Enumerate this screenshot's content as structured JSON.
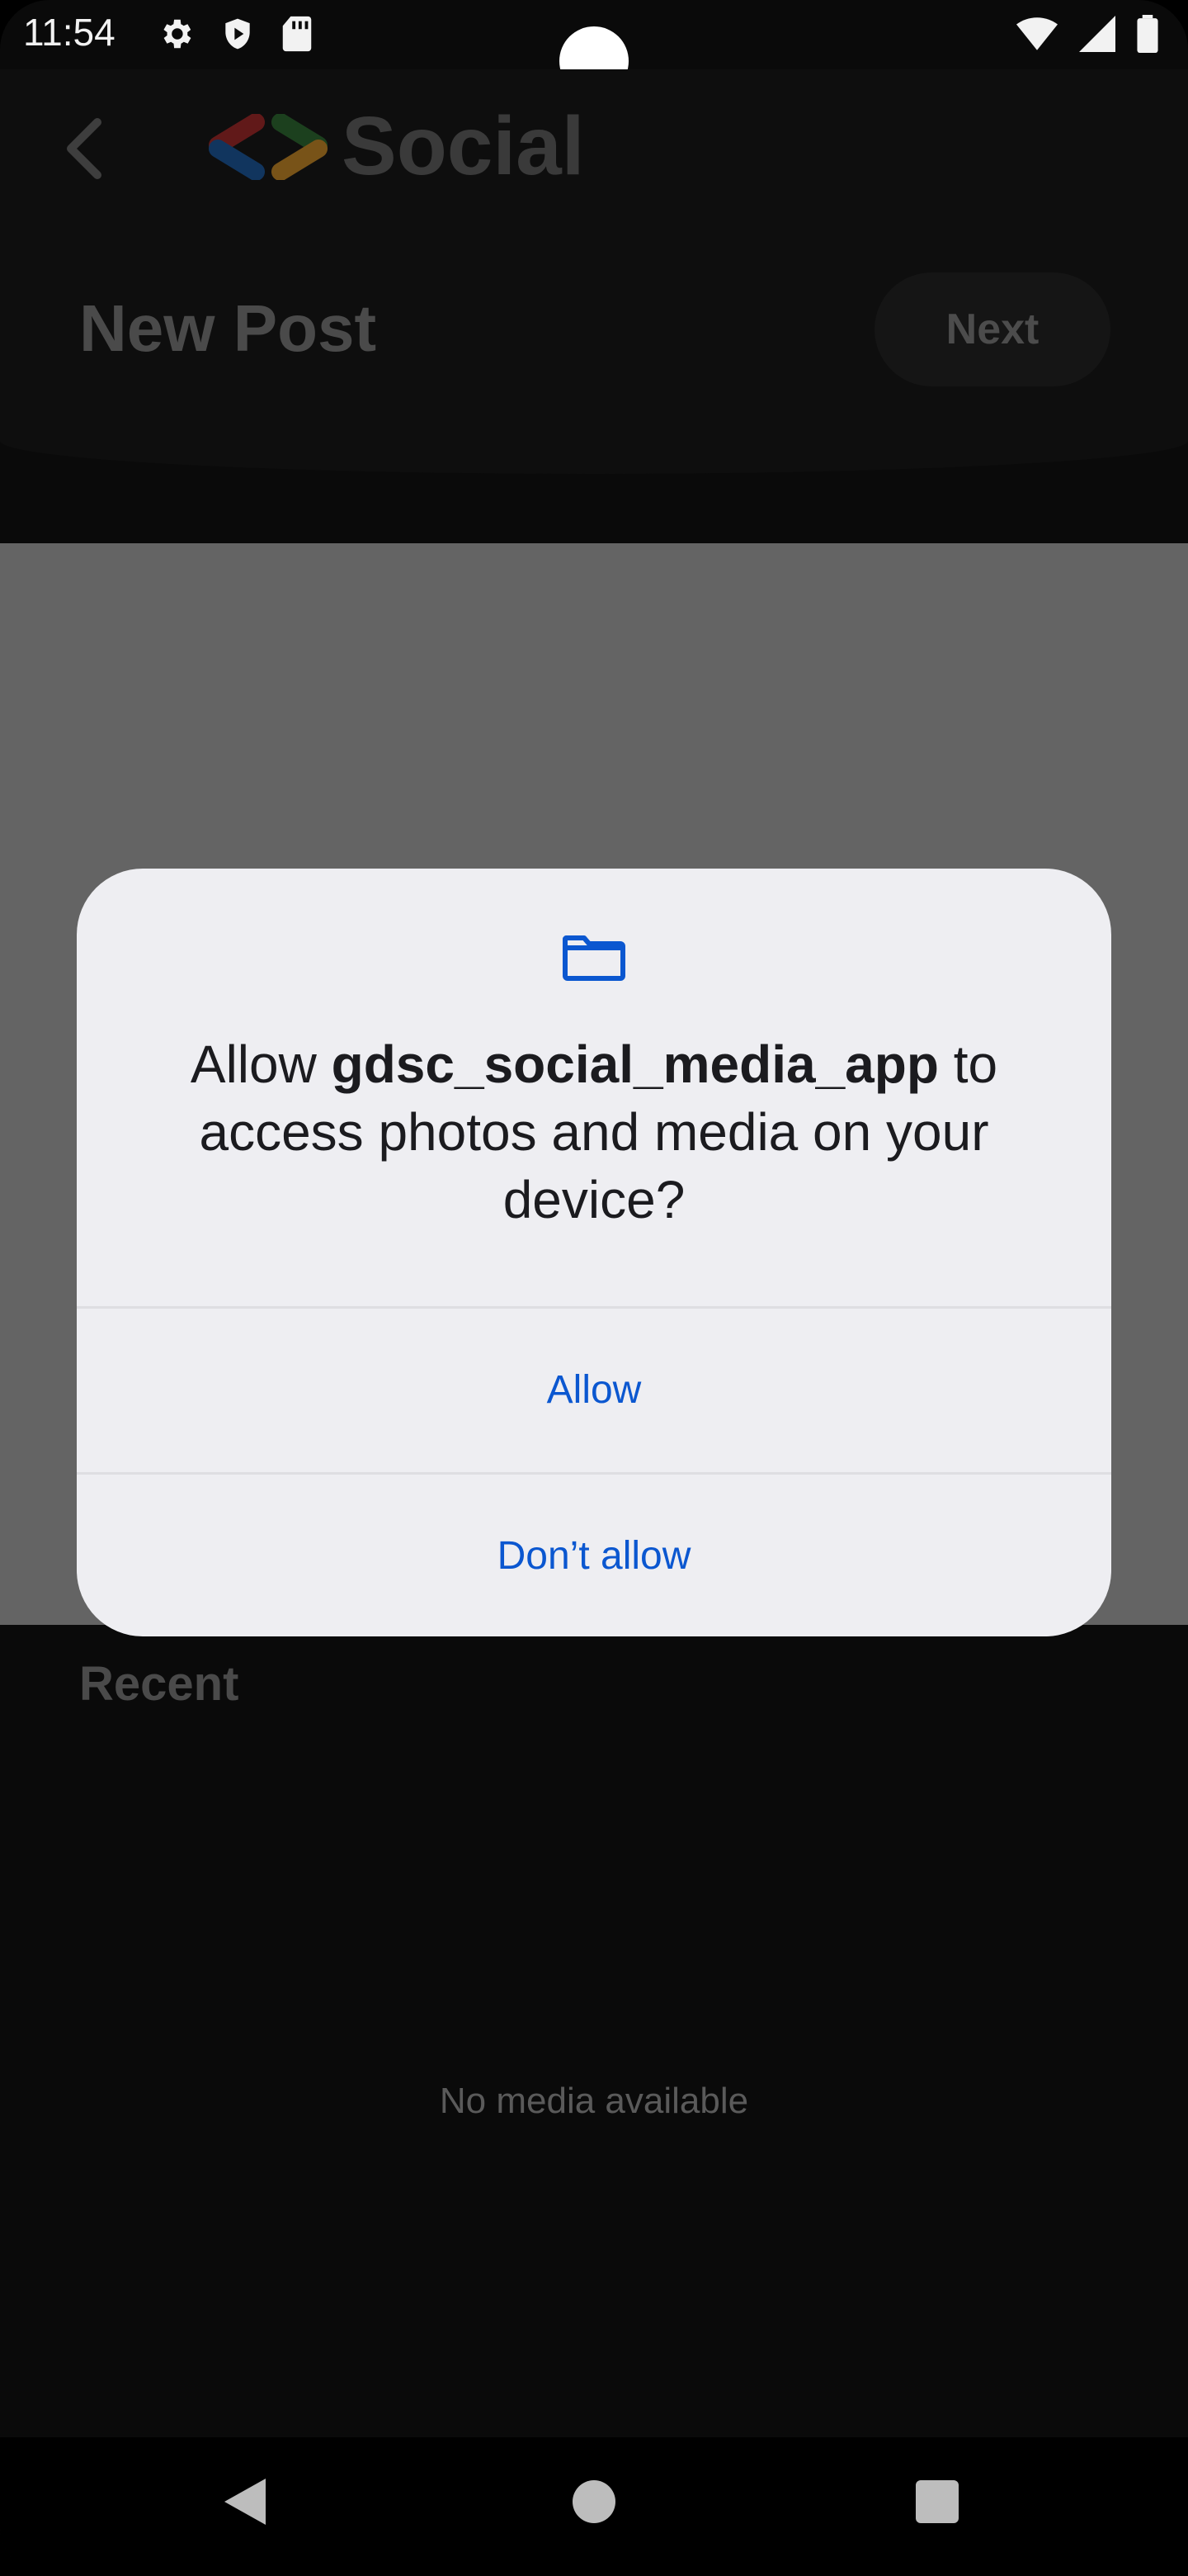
{
  "status_bar": {
    "time": "11:54",
    "icons_left": [
      "gear-icon",
      "shield-icon",
      "sd-card-icon"
    ],
    "icons_right": [
      "wifi-icon",
      "signal-icon",
      "battery-icon"
    ]
  },
  "header": {
    "app_name": "Social",
    "page_title": "New Post",
    "next_label": "Next"
  },
  "content": {
    "recent_label": "Recent",
    "empty_message": "No media available"
  },
  "dialog": {
    "prefix": "Allow ",
    "app_name": "gdsc_social_media_app",
    "suffix": " to access photos and media on your device?",
    "allow_label": "Allow",
    "deny_label": "Don’t allow"
  },
  "colors": {
    "dialog_bg": "#eeeef2",
    "button_text": "#0b57d0",
    "scrim": "#646464"
  }
}
